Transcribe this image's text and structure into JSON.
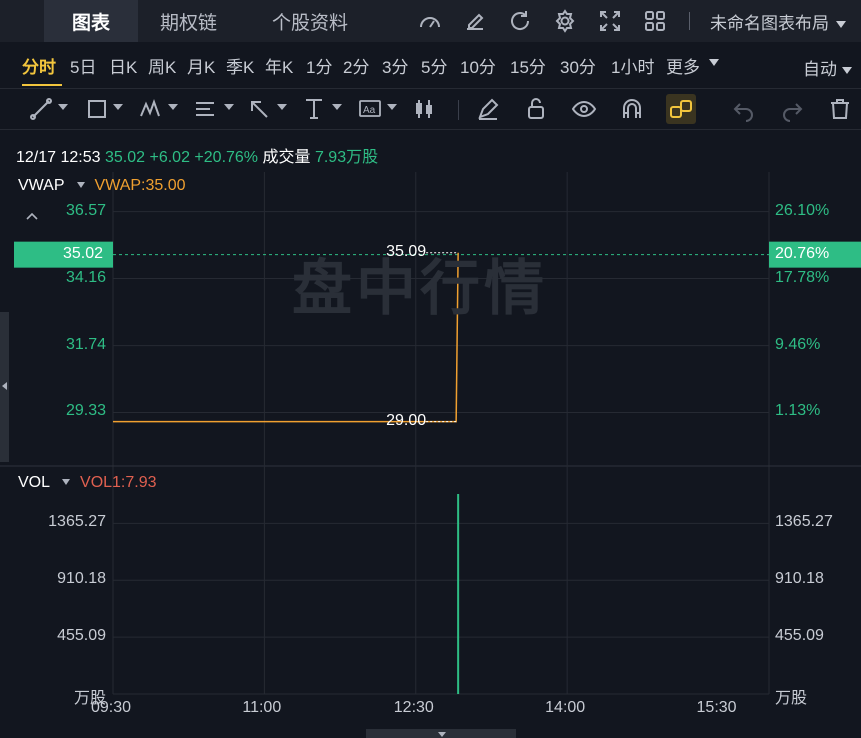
{
  "tabs": [
    {
      "label": "图表",
      "active": true
    },
    {
      "label": "期权链",
      "active": false
    },
    {
      "label": "个股资料",
      "active": false
    }
  ],
  "layout_name": "未命名图表布局",
  "periods": [
    {
      "label": "分时",
      "active": true
    },
    {
      "label": "5日"
    },
    {
      "label": "日K"
    },
    {
      "label": "周K"
    },
    {
      "label": "月K"
    },
    {
      "label": "季K"
    },
    {
      "label": "年K"
    },
    {
      "label": "1分"
    },
    {
      "label": "2分"
    },
    {
      "label": "3分"
    },
    {
      "label": "5分"
    },
    {
      "label": "10分"
    },
    {
      "label": "15分"
    },
    {
      "label": "30分"
    },
    {
      "label": "1小时"
    },
    {
      "label": "更多"
    }
  ],
  "auto_label": "自动",
  "info": {
    "datetime": "12/17 12:53",
    "price": "35.02",
    "change": "+6.02",
    "change_pct": "+20.76%",
    "volume_label": "成交量",
    "volume_value": "7.93万股"
  },
  "watermark": "盘中行情",
  "colors": {
    "up": "#2ebd85",
    "vwap": "#f0a030",
    "vol": "#e06050",
    "active": "#f2c53d"
  },
  "icons": {
    "top": [
      "gauge-icon",
      "edit-icon",
      "refresh-icon",
      "settings-icon",
      "fullscreen-icon",
      "grid-layout-icon"
    ],
    "tools": [
      "trend-line-icon",
      "rectangle-icon",
      "pattern-icon",
      "fib-icon",
      "arrow-icon",
      "measure-icon",
      "text-icon",
      "candle-icon",
      "pencil-icon",
      "lock-icon",
      "eye-icon",
      "magnet-icon",
      "link-icon",
      "undo-icon",
      "redo-icon",
      "trash-icon"
    ]
  },
  "chart_data": [
    {
      "type": "line",
      "indicator": "VWAP",
      "indicator_value": "VWAP:35.00",
      "x_ticks": [
        "09:30",
        "11:00",
        "12:30",
        "14:00",
        "15:30"
      ],
      "price_ticks": [
        "36.57",
        "34.16",
        "31.74",
        "29.33"
      ],
      "pct_ticks": [
        "26.10%",
        "17.78%",
        "9.46%",
        "1.13%"
      ],
      "ylim": [
        27.4,
        38.0
      ],
      "current_price": "35.02",
      "current_pct": "20.76%",
      "series": [
        {
          "values_x": [
            "09:30",
            "12:53",
            "12:54",
            "12:54"
          ],
          "values_y": [
            29.0,
            29.0,
            29.0,
            35.09
          ]
        }
      ],
      "annotations": [
        "35.09",
        "29.00"
      ]
    },
    {
      "type": "bar",
      "indicator": "VOL",
      "indicator_value": "VOL1:7.93",
      "y_ticks": [
        "1365.27",
        "910.18",
        "455.09"
      ],
      "unit": "万股",
      "ylim": [
        0,
        1600
      ],
      "bars": [
        {
          "x": "12:54",
          "value": 1600
        }
      ]
    }
  ]
}
